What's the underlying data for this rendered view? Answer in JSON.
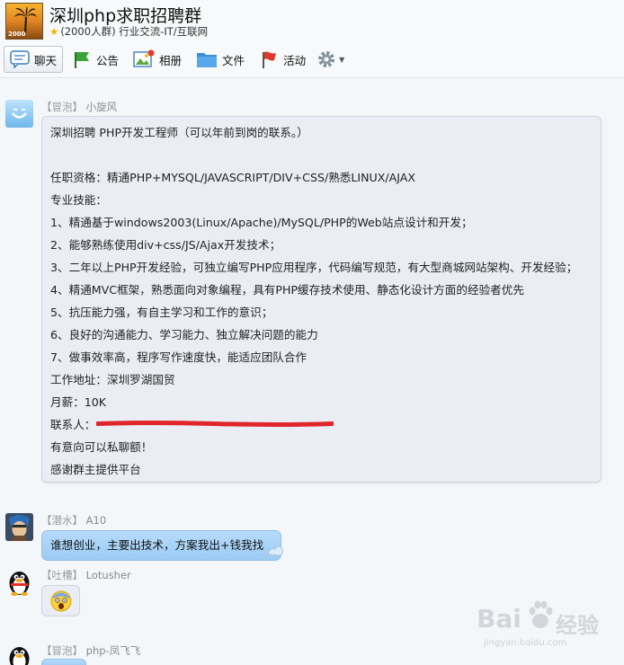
{
  "group": {
    "name": "深圳php求职招聘群",
    "meta": "(2000人群) 行业交流-IT/互联网",
    "avatar_label": "2000"
  },
  "toolbar": {
    "tabs": [
      {
        "label": "聊天",
        "icon": "chat-icon",
        "active": true
      },
      {
        "label": "公告",
        "icon": "notice-flag-icon"
      },
      {
        "label": "相册",
        "icon": "album-icon"
      },
      {
        "label": "文件",
        "icon": "folder-icon"
      },
      {
        "label": "活动",
        "icon": "activity-flag-icon"
      }
    ],
    "settings_icon": "gear-icon"
  },
  "messages": [
    {
      "badge": "【冒泡】",
      "name": "小旋风",
      "avatar_icon": "smile-avatar",
      "lines": [
        "深圳招聘  PHP开发工程师（可以年前到岗的联系。）",
        "",
        "任职资格：精通PHP+MYSQL/JAVASCRIPT/DIV+CSS/熟悉LINUX/AJAX",
        "专业技能：",
        "1、精通基于windows2003(Linux/Apache)/MySQL/PHP的Web站点设计和开发；",
        "2、能够熟练使用div+css/JS/Ajax开发技术；",
        "3、二年以上PHP开发经验，可独立编写PHP应用程序，代码编写规范，有大型商城网站架构、开发经验；",
        "4、精通MVC框架，熟悉面向对象编程，具有PHP缓存技术使用、静态化设计方面的经验者优先",
        "5、抗压能力强，有自主学习和工作的意识；",
        "6、良好的沟通能力、学习能力、独立解决问题的能力",
        "7、做事效率高，程序写作速度快，能适应团队合作",
        "工作地址：深圳罗湖国贸",
        "月薪：10K",
        "联系人：",
        "有意向可以私聊额！",
        "感谢群主提供平台"
      ]
    },
    {
      "badge": "【潜水】",
      "name": "A10",
      "avatar_icon": "warrior-avatar",
      "text": "谁想创业，主要出技术，方案我出+钱我找"
    },
    {
      "badge": "【吐槽】",
      "name": "Lotusher",
      "avatar_icon": "penguin-avatar",
      "emoji": "scared-face-emoji"
    },
    {
      "badge": "【冒泡】",
      "name": "php-凤飞飞",
      "avatar_icon": "penguin-avatar"
    }
  ],
  "watermark": {
    "brand": "Bai",
    "brand_suffix": "经验",
    "url": "jingyan.baidu.com"
  },
  "colors": {
    "bubble_gray": "#eaedf3",
    "bubble_blue": "#a9d3f7",
    "redact_red": "#e1262b"
  }
}
